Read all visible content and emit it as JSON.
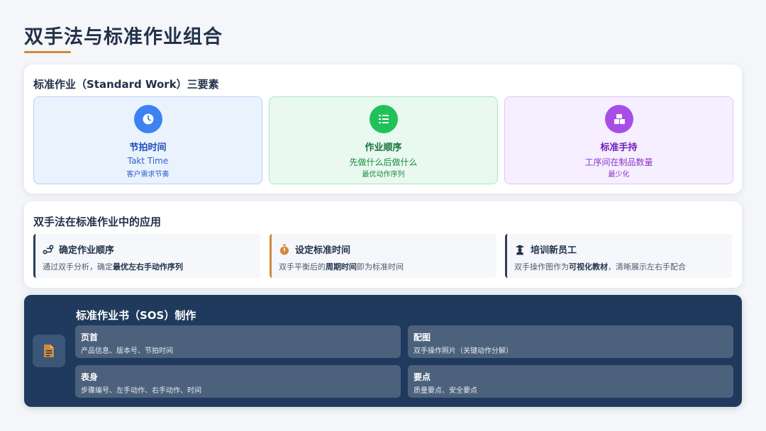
{
  "slide": {
    "title": "双手法与标准作业组合"
  },
  "standard_work": {
    "heading": "标准作业（Standard Work）三要素",
    "elements": [
      {
        "name": "节拍时间",
        "subtitle": "Takt Time",
        "note": "客户需求节奏",
        "icon": "clock-icon",
        "color": "#3d82f0"
      },
      {
        "name": "作业顺序",
        "subtitle": "先做什么后做什么",
        "note": "最优动作序列",
        "icon": "list-ordered-icon",
        "color": "#21c15a"
      },
      {
        "name": "标准手持",
        "subtitle": "工序间在制品数量",
        "note": "最少化",
        "icon": "boxes-icon",
        "color": "#a84ee8"
      }
    ]
  },
  "applications": {
    "heading": "双手法在标准作业中的应用",
    "items": [
      {
        "title": "确定作业顺序",
        "desc_prefix": "通过双手分析，确定",
        "desc_bold": "最优左右手动作序列",
        "desc_suffix": "",
        "icon": "route-icon"
      },
      {
        "title": "设定标准时间",
        "desc_prefix": "双手平衡后的",
        "desc_bold": "周期时间",
        "desc_suffix": "即为标准时间",
        "icon": "stopwatch-icon"
      },
      {
        "title": "培训新员工",
        "desc_prefix": "双手操作图作为",
        "desc_bold": "可视化教材",
        "desc_suffix": "，清晰展示左右手配合",
        "icon": "teacher-icon"
      }
    ]
  },
  "sos": {
    "heading": "标准作业书（SOS）制作",
    "icon": "document-icon",
    "cells": [
      {
        "title": "页首",
        "desc": "产品信息、版本号、节拍时间"
      },
      {
        "title": "配图",
        "desc": "双手操作照片（关键动作分解）"
      },
      {
        "title": "表身",
        "desc": "步骤编号、左手动作、右手动作、时间"
      },
      {
        "title": "要点",
        "desc": "质量要点、安全要点"
      }
    ]
  },
  "colors": {
    "accent": "#d08a3c",
    "navy": "#1f3a5c"
  }
}
